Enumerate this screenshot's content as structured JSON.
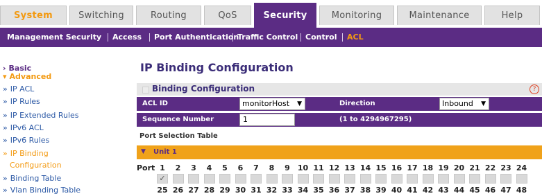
{
  "tabs": [
    {
      "label": "System",
      "state": "first"
    },
    {
      "label": "Switching",
      "state": ""
    },
    {
      "label": "Routing",
      "state": ""
    },
    {
      "label": "QoS",
      "state": ""
    },
    {
      "label": "Security",
      "state": "active"
    },
    {
      "label": "Monitoring",
      "state": ""
    },
    {
      "label": "Maintenance",
      "state": ""
    },
    {
      "label": "Help",
      "state": ""
    }
  ],
  "subnav": [
    {
      "label": "Management Security"
    },
    {
      "label": "Access"
    },
    {
      "label": "Port Authentication"
    },
    {
      "label": "Traffic Control"
    },
    {
      "label": "Control"
    },
    {
      "label": "ACL",
      "active": true
    }
  ],
  "leftnav": [
    {
      "label": "Basic",
      "kind": "group",
      "prefix": "›"
    },
    {
      "label": "Advanced",
      "kind": "group2",
      "prefix": "▾"
    },
    {
      "label": "IP ACL",
      "kind": "",
      "prefix": "»"
    },
    {
      "label": "IP Rules",
      "kind": "",
      "prefix": "»"
    },
    {
      "label": "IP Extended Rules",
      "kind": "",
      "prefix": "»"
    },
    {
      "label": "IPv6 ACL",
      "kind": "",
      "prefix": "»"
    },
    {
      "label": "IPv6 Rules",
      "kind": "",
      "prefix": "»"
    },
    {
      "label": "IP Binding",
      "kind": "cur",
      "prefix": "»"
    },
    {
      "label": "Configuration",
      "kind": "cur2",
      "prefix": ""
    },
    {
      "label": "Binding Table",
      "kind": "",
      "prefix": "»"
    },
    {
      "label": "Vlan Binding Table",
      "kind": "",
      "prefix": "»"
    }
  ],
  "page_title": "IP Binding Configuration",
  "panel": {
    "title": "Binding Configuration",
    "help": "?",
    "acl_id_label": "ACL ID",
    "acl_id_value": "monitorHost",
    "direction_label": "Direction",
    "direction_value": "Inbound",
    "seq_label": "Sequence Number",
    "seq_value": "1",
    "seq_range": "(1 to 4294967295)",
    "port_table_label": "Port Selection Table",
    "unit_label": "Unit 1",
    "port_label": "Port",
    "ports_top": [
      "1",
      "2",
      "3",
      "4",
      "5",
      "6",
      "7",
      "8",
      "9",
      "10",
      "11",
      "12",
      "13",
      "14",
      "15",
      "16",
      "17",
      "18",
      "19",
      "20",
      "21",
      "22",
      "23",
      "24"
    ],
    "ports_bottom": [
      "25",
      "26",
      "27",
      "28",
      "29",
      "30",
      "31",
      "32",
      "33",
      "34",
      "35",
      "36",
      "37",
      "38",
      "39",
      "40",
      "41",
      "42",
      "43",
      "44",
      "45",
      "46",
      "47",
      "48"
    ],
    "checked_ports": [
      "1"
    ],
    "check_glyph": "✓"
  },
  "colors": {
    "brand_purple": "#5b2c84",
    "accent_orange": "#f39a12"
  }
}
